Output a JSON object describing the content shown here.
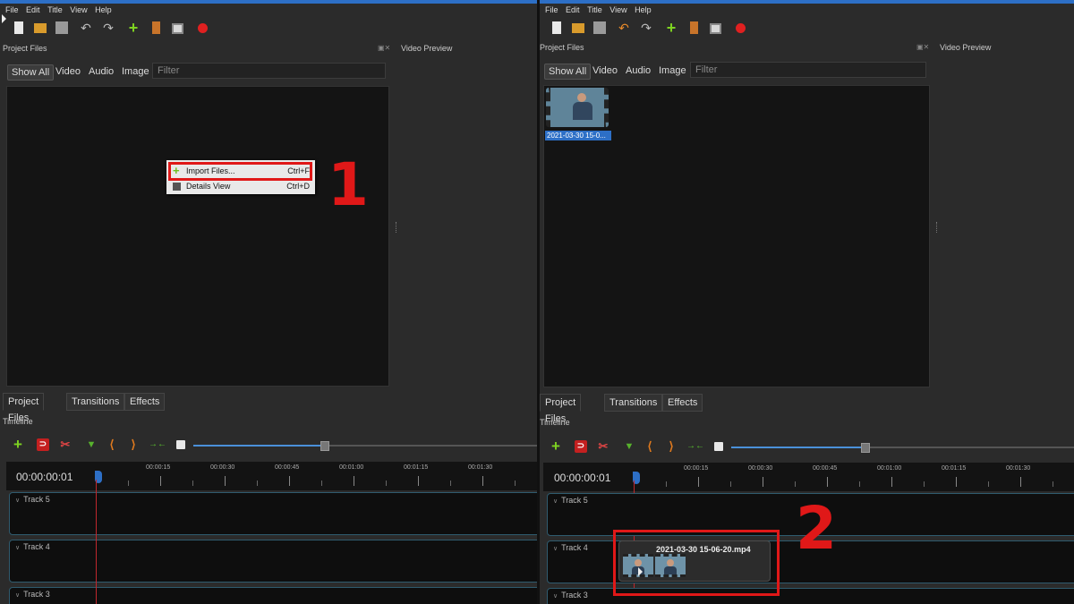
{
  "menu": [
    "File",
    "Edit",
    "Title",
    "View",
    "Help"
  ],
  "toolbar_icons": [
    "new-file-icon",
    "open-folder-icon",
    "save-icon",
    "undo-icon",
    "redo-icon",
    "add-icon",
    "film-icon",
    "fullscreen-icon",
    "record-icon"
  ],
  "project_files": {
    "title": "Project Files",
    "filter_tabs": [
      "Show All",
      "Video",
      "Audio",
      "Image"
    ],
    "filter_placeholder": "Filter"
  },
  "video_preview_title": "Video Preview",
  "context_menu": {
    "items": [
      {
        "label": "Import Files...",
        "shortcut": "Ctrl+F"
      },
      {
        "label": "Details View",
        "shortcut": "Ctrl+D"
      }
    ]
  },
  "bottom_tabs": [
    "Project Files",
    "Transitions",
    "Effects"
  ],
  "timeline": {
    "title": "Timeline",
    "timecode": "00:00:00:01",
    "ruler_labels": [
      "00:00:15",
      "00:00:30",
      "00:00:45",
      "00:01:00",
      "00:01:15",
      "00:01:30"
    ],
    "tracks": [
      "Track 5",
      "Track 4",
      "Track 3"
    ]
  },
  "imported_file": {
    "thumb_label": "2021-03-30 15-0...",
    "clip_name": "2021-03-30 15-06-20.mp4"
  },
  "annotations": {
    "step1": "1",
    "step2": "2"
  },
  "colors": {
    "highlight": "#e01818",
    "accent": "#2d6fc6"
  }
}
